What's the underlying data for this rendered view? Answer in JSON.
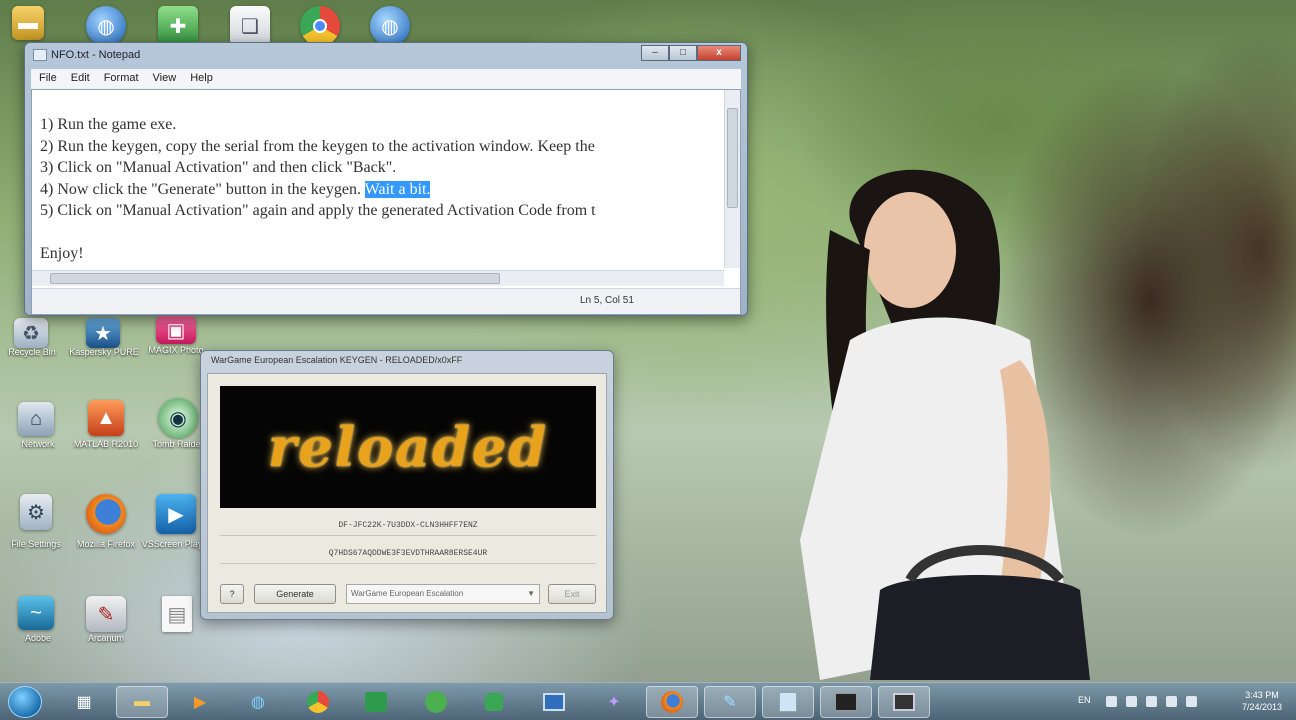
{
  "notepad": {
    "title": "NFO.txt - Notepad",
    "menu": [
      "File",
      "Edit",
      "Format",
      "View",
      "Help"
    ],
    "lines": [
      "1) Run the game exe.",
      "2) Run the keygen, copy the serial from the keygen to the activation window. Keep the",
      "3) Click on \"Manual Activation\" and then click \"Back\".",
      "4) Now click the \"Generate\" button in the keygen. ",
      "5) Click on \"Manual Activation\" again and apply the generated Activation Code from t",
      "",
      "Enjoy!"
    ],
    "selected_text": "Wait a bit.",
    "status": "Ln 5, Col 51",
    "window_buttons": [
      "–",
      "□",
      "x"
    ]
  },
  "keygen": {
    "title": "WarGame European Escalation KEYGEN - RELOADED/x0xFF",
    "logo_text": "reloaded",
    "serial": "DF-JFC22K-7U3DDX-CLN3HHFF7ENZ",
    "activation_code": "Q7HDS67AQDDWE3F3EVDTHRAAR8ERSE4UR",
    "help_button": "?",
    "generate_button": "Generate",
    "product_select": "WarGame European Escalation",
    "extra_button": "Exit"
  },
  "desktop_icons": [
    {
      "label": "",
      "icon": "folder-icon"
    },
    {
      "label": "",
      "icon": "globe-icon"
    },
    {
      "label": "",
      "icon": "app-icon"
    },
    {
      "label": "",
      "icon": "doc-icon"
    },
    {
      "label": "",
      "icon": "chrome-icon"
    },
    {
      "label": "",
      "icon": "globe-icon"
    },
    {
      "label": "Recycle Bin",
      "icon": "recycle-bin-icon"
    },
    {
      "label": "Kaspersky PURE",
      "icon": "kaspersky-icon"
    },
    {
      "label": "MAGIX Photo",
      "icon": "photo-icon"
    },
    {
      "label": "Network",
      "icon": "network-icon"
    },
    {
      "label": "MATLAB R2010",
      "icon": "matlab-icon"
    },
    {
      "label": "Tomb Raider",
      "icon": "game-icon"
    },
    {
      "label": "File Settings",
      "icon": "settings-icon"
    },
    {
      "label": "Mozilla Firefox",
      "icon": "firefox-icon"
    },
    {
      "label": "VSScreen Player",
      "icon": "video-icon"
    },
    {
      "label": "Adobe",
      "icon": "adobe-icon"
    },
    {
      "label": "Arcanum",
      "icon": "arcanum-icon"
    },
    {
      "label": "",
      "icon": "file-icon"
    }
  ],
  "taskbar": {
    "items": [
      {
        "icon": "notes-icon",
        "active": false
      },
      {
        "icon": "folder-icon",
        "active": true
      },
      {
        "icon": "media-player-icon",
        "active": false
      },
      {
        "icon": "network-icon",
        "active": false
      },
      {
        "icon": "chrome-icon",
        "active": false
      },
      {
        "icon": "excel-icon",
        "active": false
      },
      {
        "icon": "xbox-icon",
        "active": false
      },
      {
        "icon": "green-app-icon",
        "active": false
      },
      {
        "icon": "window-icon",
        "active": false
      },
      {
        "icon": "yahoo-icon",
        "active": false
      },
      {
        "icon": "firefox-icon",
        "active": true
      },
      {
        "icon": "tool-icon",
        "active": true
      },
      {
        "icon": "notepad-icon",
        "active": true
      },
      {
        "icon": "keygen-icon",
        "active": true
      },
      {
        "icon": "monitor-icon",
        "active": true
      }
    ],
    "language": "EN",
    "time": "3:43 PM",
    "date": "7/24/2013"
  }
}
